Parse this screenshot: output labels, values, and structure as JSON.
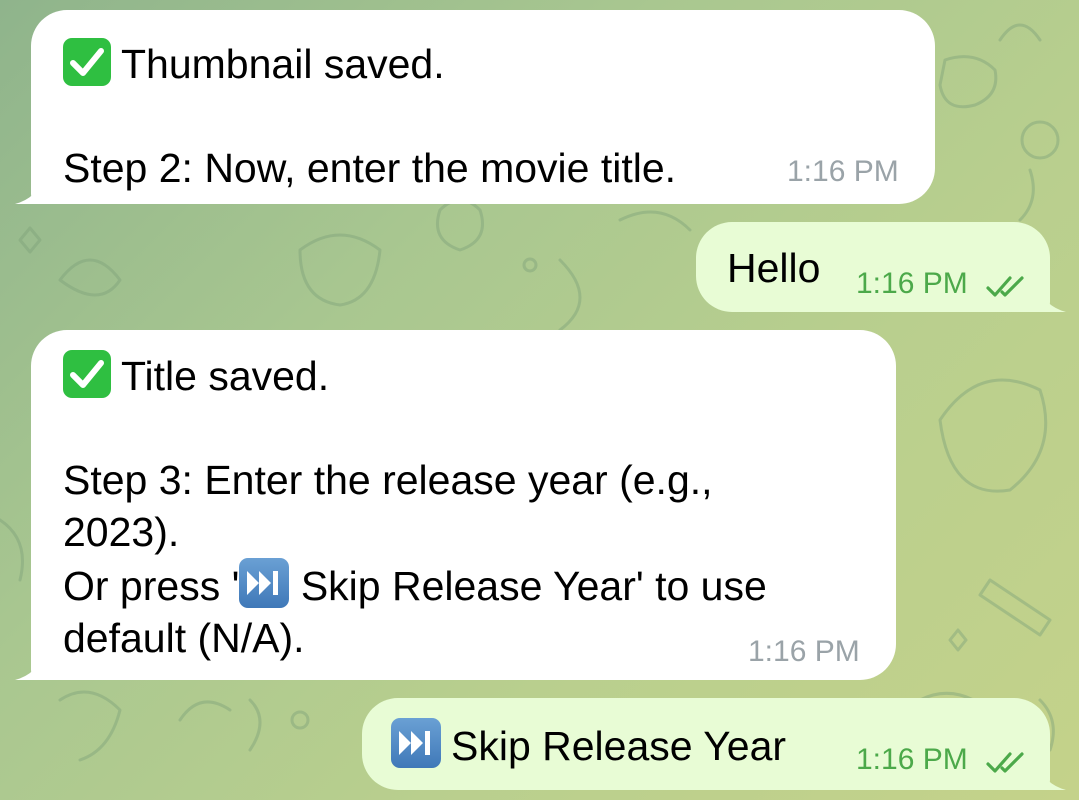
{
  "messages": [
    {
      "direction": "incoming",
      "emoji": "check-mark-icon",
      "line1": "Thumbnail saved.",
      "line2": "Step 2: Now, enter the movie title.",
      "time": "1:16 PM"
    },
    {
      "direction": "outgoing",
      "text": "Hello",
      "time": "1:16 PM",
      "status": "read-double-check-icon"
    },
    {
      "direction": "incoming",
      "emoji": "check-mark-icon",
      "line1": "Title saved.",
      "line2": "Step 3: Enter the release year (e.g.,",
      "line3": "2023).",
      "line4_prefix": "Or press '",
      "line4_emoji": "next-track-icon",
      "line4_suffix": " Skip Release Year' to use",
      "line5": "default (N/A).",
      "time": "1:16 PM"
    },
    {
      "direction": "outgoing",
      "emoji": "next-track-icon",
      "text": "Skip Release Year",
      "time": "1:16 PM",
      "status": "read-double-check-icon"
    }
  ],
  "colors": {
    "incoming_bubble": "#ffffff",
    "outgoing_bubble": "#e8fcd5",
    "outgoing_time": "#4ca94a",
    "incoming_time": "#9aa3a8",
    "check_emoji": "#2fbf41",
    "skip_emoji": "#4a84c2"
  }
}
